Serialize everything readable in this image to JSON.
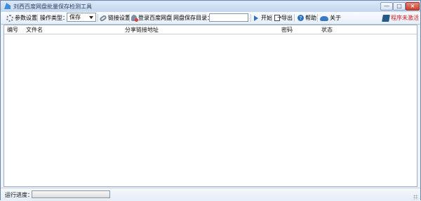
{
  "window": {
    "title": "刘西百度网盘批量保存检测工具",
    "controls": {
      "minimize": "—",
      "maximize": "□",
      "close": "×"
    }
  },
  "toolbar": {
    "settings_label": "参数设置",
    "operation_type_label": "操作类型：",
    "operation_value": "保存",
    "link_settings_label": "链接设置",
    "login_label": "登录百度网盘",
    "save_dir_label": "网盘保存目录：",
    "save_dir_value": "",
    "start_label": "开始",
    "export_label": "导出",
    "help_label": "帮助",
    "about_label": "关于",
    "activation_status": "程序未激活"
  },
  "table": {
    "columns": [
      "编号",
      "文件名",
      "分享链接地址",
      "密码",
      "状态"
    ],
    "rows": []
  },
  "status": {
    "progress_label": "运行进度：",
    "progress_fraction": 0
  },
  "colors": {
    "accent": "#3f8ed8",
    "warning": "#d4161d",
    "progress": "#4aa25f"
  }
}
